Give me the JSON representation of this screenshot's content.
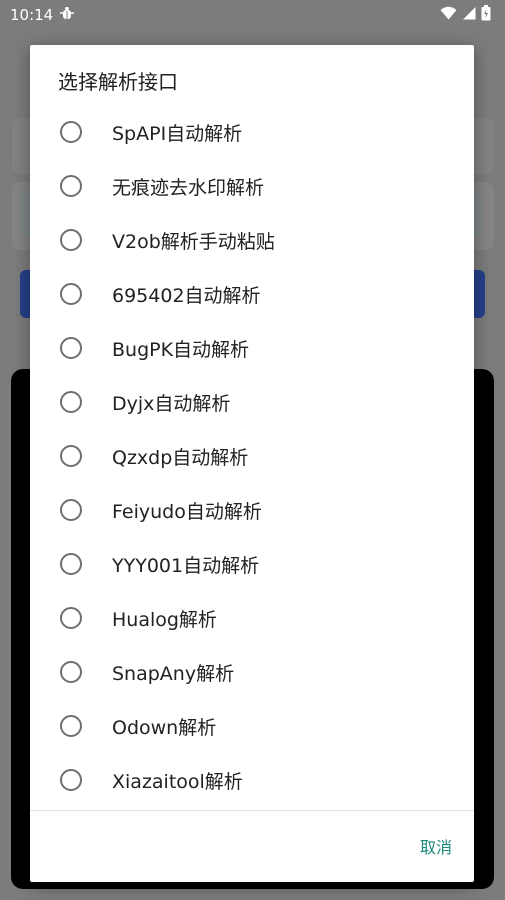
{
  "status_bar": {
    "time": "10:14",
    "notification_icon": "bug-icon",
    "wifi_icon": "wifi-icon",
    "signal_icon": "signal-icon",
    "battery_icon": "battery-icon"
  },
  "dialog": {
    "title": "选择解析接口",
    "options": [
      {
        "label": "SpAPI自动解析",
        "selected": false
      },
      {
        "label": "无痕迹去水印解析",
        "selected": false
      },
      {
        "label": "V2ob解析手动粘贴",
        "selected": false
      },
      {
        "label": "695402自动解析",
        "selected": false
      },
      {
        "label": "BugPK自动解析",
        "selected": false
      },
      {
        "label": "Dyjx自动解析",
        "selected": false
      },
      {
        "label": "Qzxdp自动解析",
        "selected": false
      },
      {
        "label": "Feiyudo自动解析",
        "selected": false
      },
      {
        "label": "YYY001自动解析",
        "selected": false
      },
      {
        "label": "Hualog解析",
        "selected": false
      },
      {
        "label": "SnapAny解析",
        "selected": false
      },
      {
        "label": "Odown解析",
        "selected": false
      },
      {
        "label": "Xiazaitool解析",
        "selected": false
      }
    ],
    "cancel_label": "取消"
  },
  "colors": {
    "accent": "#1c8a7c",
    "scrim": "#7c7c7c",
    "radio_border": "#6f6f6f"
  }
}
